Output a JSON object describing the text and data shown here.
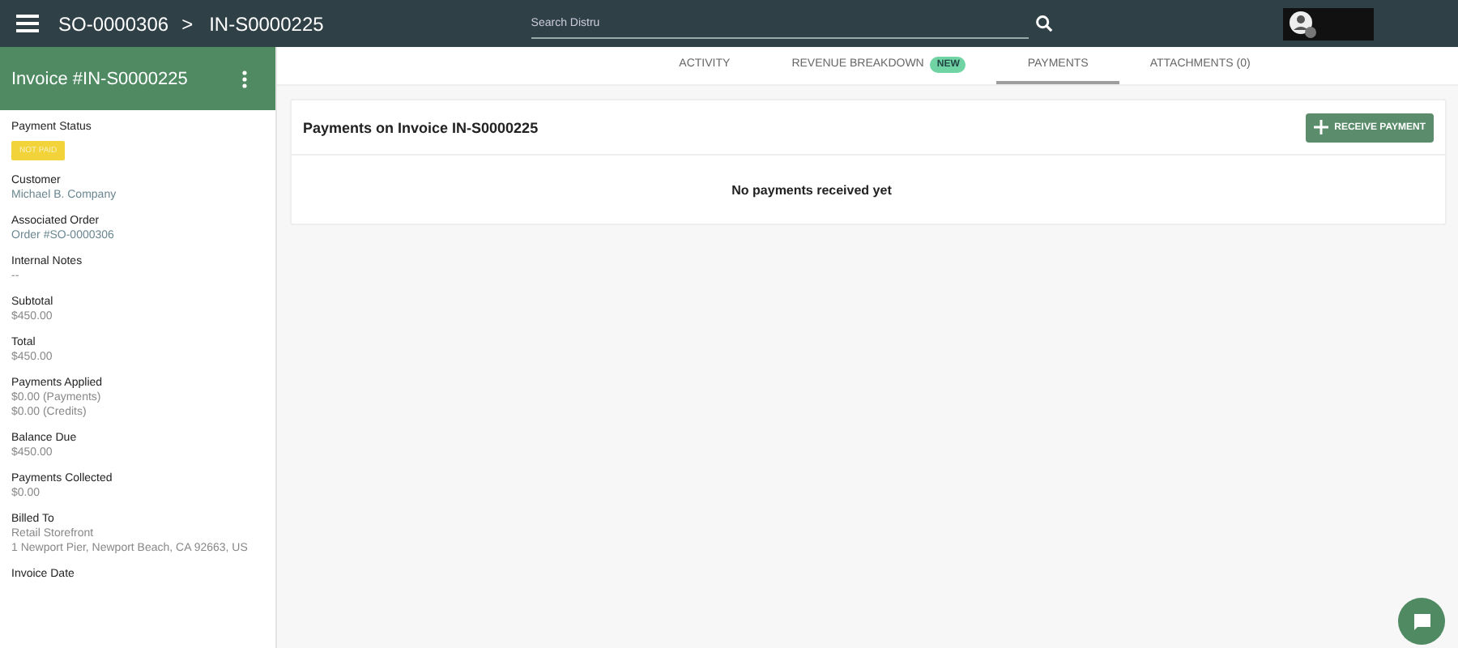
{
  "topbar": {
    "breadcrumbs": [
      "SO-0000306",
      "IN-S0000225"
    ],
    "separator": ">",
    "search": {
      "placeholder": "Search Distru"
    }
  },
  "sidebar": {
    "title": "Invoice #IN-S0000225",
    "status": {
      "label": "Payment Status",
      "badge": "NOT PAID"
    },
    "fields": [
      {
        "label": "Customer",
        "values": [
          "Michael B. Company"
        ],
        "kind": "link"
      },
      {
        "label": "Associated Order",
        "values": [
          "Order #SO-0000306"
        ],
        "kind": "link"
      },
      {
        "label": "Internal Notes",
        "values": [
          "--"
        ],
        "kind": "text"
      },
      {
        "label": "Subtotal",
        "values": [
          "$450.00"
        ],
        "kind": "text"
      },
      {
        "label": "Total",
        "values": [
          "$450.00"
        ],
        "kind": "text"
      },
      {
        "label": "Payments Applied",
        "values": [
          "$0.00 (Payments)",
          "$0.00 (Credits)"
        ],
        "kind": "text"
      },
      {
        "label": "Balance Due",
        "values": [
          "$450.00"
        ],
        "kind": "text"
      },
      {
        "label": "Payments Collected",
        "values": [
          "$0.00"
        ],
        "kind": "text"
      },
      {
        "label": "Billed To",
        "values": [
          "Retail Storefront",
          "1 Newport Pier, Newport Beach, CA 92663, US"
        ],
        "kind": "text"
      },
      {
        "label": "Invoice Date"
      }
    ]
  },
  "tabs": [
    {
      "label": "ACTIVITY",
      "selected": false
    },
    {
      "label": "REVENUE BREAKDOWN",
      "badge": "NEW",
      "selected": false
    },
    {
      "label": "PAYMENTS",
      "selected": true
    },
    {
      "label": "ATTACHMENTS (0)",
      "selected": false
    }
  ],
  "payments": {
    "title": "Payments on Invoice IN-S0000225",
    "button": "RECEIVE PAYMENT",
    "empty": "No payments received yet"
  }
}
